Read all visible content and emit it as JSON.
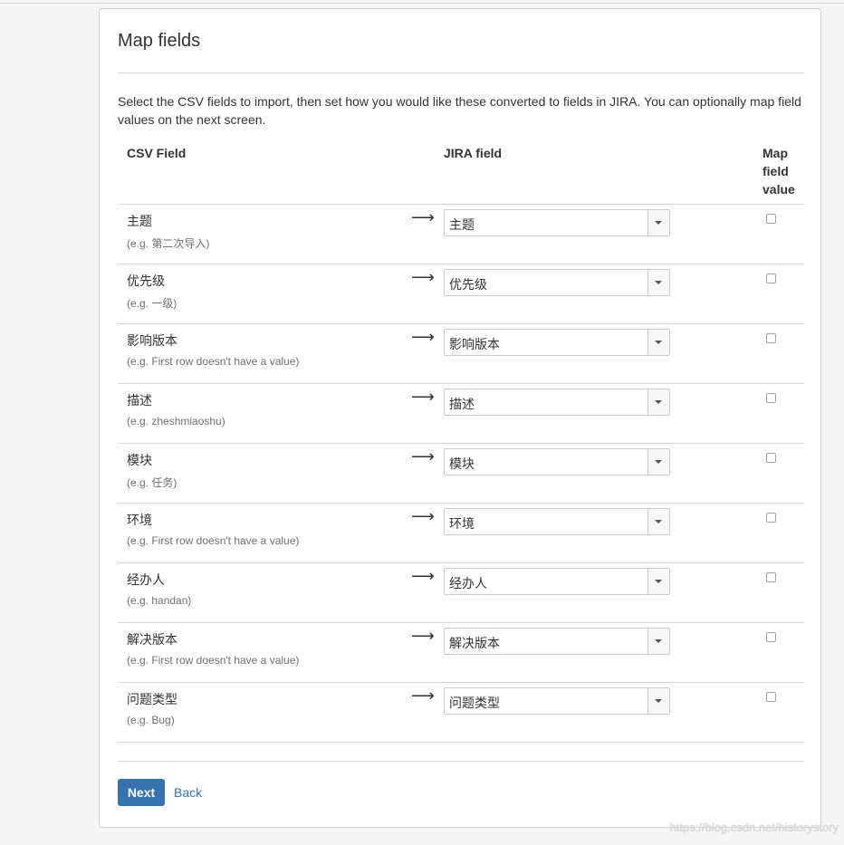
{
  "page": {
    "title": "Map fields",
    "description": "Select the CSV fields to import, then set how you would like these converted to fields in JIRA. You can optionally map field values on the next screen."
  },
  "table": {
    "headers": {
      "csv_field": "CSV Field",
      "jira_field": "JIRA field",
      "map_field_value": "Map field value"
    },
    "arrow": "⟶",
    "rows": [
      {
        "csv_name": "主题",
        "example": "(e.g. 第二次导入)",
        "jira_field": "主题",
        "map_checked": false
      },
      {
        "csv_name": "优先级",
        "example": "(e.g. 一级)",
        "jira_field": "优先级",
        "map_checked": false
      },
      {
        "csv_name": "影响版本",
        "example": "(e.g. First row doesn't have a value)",
        "jira_field": "影响版本",
        "map_checked": false
      },
      {
        "csv_name": "描述",
        "example": "(e.g. zheshmiaoshu)",
        "jira_field": "描述",
        "map_checked": false
      },
      {
        "csv_name": "模块",
        "example": "(e.g. 任务)",
        "jira_field": "模块",
        "map_checked": false
      },
      {
        "csv_name": "环境",
        "example": "(e.g. First row doesn't have a value)",
        "jira_field": "环境",
        "map_checked": false
      },
      {
        "csv_name": "经办人",
        "example": "(e.g. handan)",
        "jira_field": "经办人",
        "map_checked": false
      },
      {
        "csv_name": "解决版本",
        "example": "(e.g. First row doesn't have a value)",
        "jira_field": "解决版本",
        "map_checked": false
      },
      {
        "csv_name": "问题类型",
        "example": "(e.g. Bug)",
        "jira_field": "问题类型",
        "map_checked": false
      }
    ]
  },
  "actions": {
    "next_label": "Next",
    "back_label": "Back"
  },
  "watermark": "https://blog.csdn.net/historystory",
  "colors": {
    "primary": "#3572b0",
    "border": "#d8d8d8"
  }
}
